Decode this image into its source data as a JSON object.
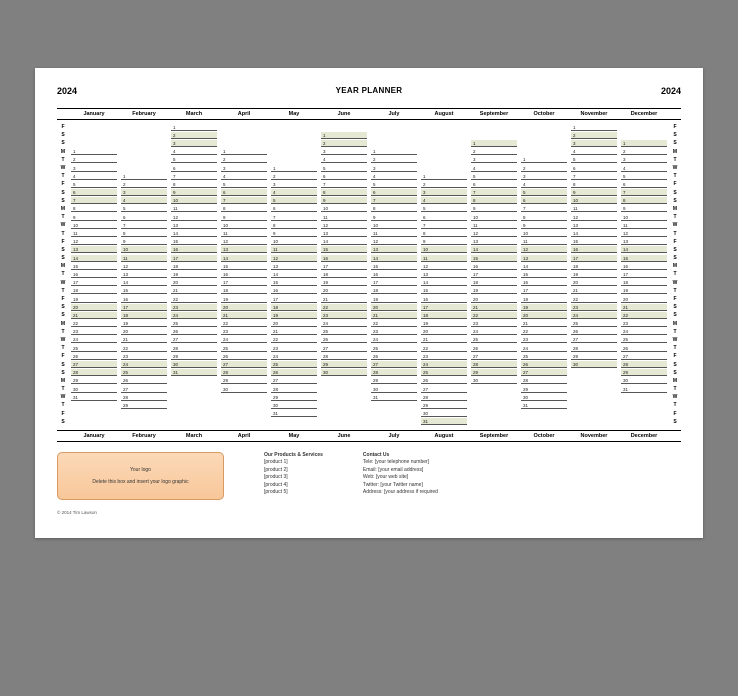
{
  "header": {
    "year": "2024",
    "title": "YEAR PLANNER"
  },
  "months": [
    "January",
    "February",
    "March",
    "April",
    "May",
    "June",
    "July",
    "August",
    "September",
    "October",
    "November",
    "December"
  ],
  "months_days": [
    31,
    29,
    31,
    30,
    31,
    30,
    31,
    31,
    30,
    31,
    30,
    31
  ],
  "months_start_dow": [
    1,
    4,
    5,
    1,
    3,
    6,
    1,
    4,
    0,
    2,
    5,
    0
  ],
  "grid_rows": 37,
  "day_letters": [
    "S",
    "M",
    "T",
    "W",
    "T",
    "F",
    "S"
  ],
  "first_row_dow": 5,
  "weekend_dows": [
    0,
    6
  ],
  "footer": {
    "logo": {
      "line1": "Your logo",
      "line2": "Delete this box and insert your logo graphic"
    },
    "products": {
      "heading": "Our Products & Services",
      "items": [
        "[product 1]",
        "[product 2]",
        "[product 3]",
        "[product 4]",
        "[product 5]"
      ]
    },
    "contact": {
      "heading": "Contact Us",
      "lines": [
        "Tele: [your telephone number]",
        "Email: [your email address]",
        "Web: [your web site]",
        "Twitter: [your Twitter name]",
        "Address: [your address if required"
      ]
    },
    "copyright": "© 2014 Tim Lawson"
  }
}
